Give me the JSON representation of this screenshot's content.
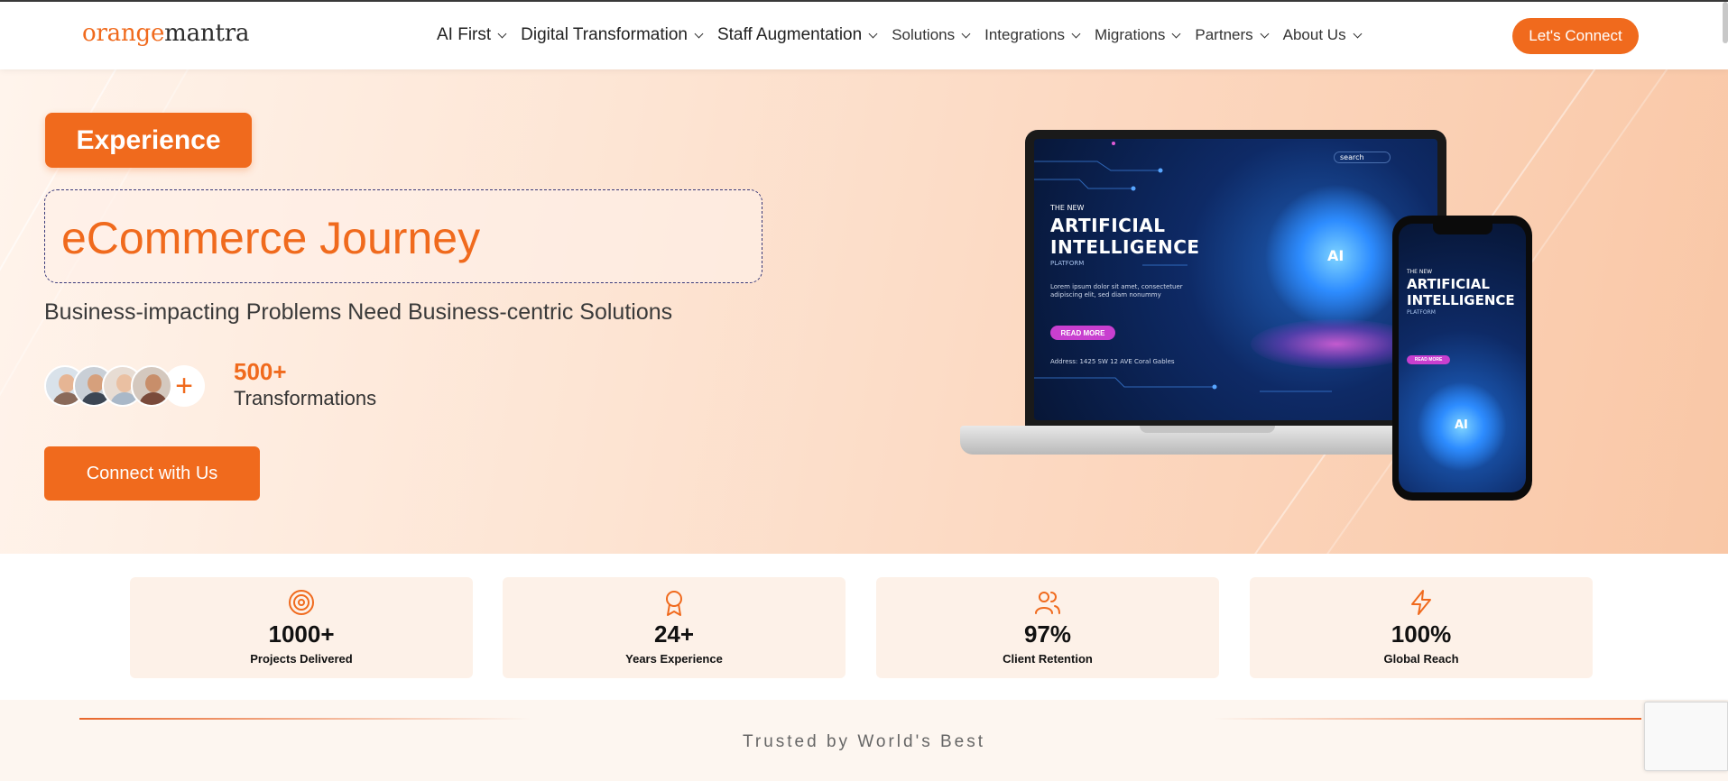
{
  "header": {
    "logo": {
      "part1": "orange",
      "part2": "mantra"
    },
    "nav": [
      {
        "label": "AI First",
        "size": "big"
      },
      {
        "label": "Digital Transformation",
        "size": "big"
      },
      {
        "label": "Staff Augmentation",
        "size": "big"
      },
      {
        "label": "Solutions",
        "size": "small"
      },
      {
        "label": "Integrations",
        "size": "small"
      },
      {
        "label": "Migrations",
        "size": "small"
      },
      {
        "label": "Partners",
        "size": "small"
      },
      {
        "label": "About Us",
        "size": "small"
      }
    ],
    "cta_label": "Let's Connect"
  },
  "hero": {
    "badge": "Experience",
    "headline": "eCommerce Journey",
    "subline": "Business-impacting Problems Need Business-centric Solutions",
    "avatar_plus": "+",
    "stat_value": "500+",
    "stat_label": "Transformations",
    "cta_label": "Connect with Us",
    "laptop_screen": {
      "search": "search",
      "eyebrow": "THE NEW",
      "title_line1": "ARTIFICIAL",
      "title_line2": "INTELLIGENCE",
      "platform": "PLATFORM",
      "body": "Lorem ipsum dolor sit amet, consectetuer adipiscing elit, sed diam nonummy",
      "button": "READ MORE",
      "address": "Address: 1425 SW 12 AVE Coral Gables",
      "ai_badge": "AI"
    },
    "phone_screen": {
      "eyebrow": "THE NEW",
      "title_line1": "ARTIFICIAL",
      "title_line2": "INTELLIGENCE",
      "platform": "PLATFORM",
      "button": "READ MORE",
      "ai_badge": "AI"
    }
  },
  "stats": [
    {
      "icon": "target-icon",
      "value": "1000+",
      "label": "Projects Delivered"
    },
    {
      "icon": "award-icon",
      "value": "24+",
      "label": "Years Experience"
    },
    {
      "icon": "users-icon",
      "value": "97%",
      "label": "Client Retention"
    },
    {
      "icon": "lightning-icon",
      "value": "100%",
      "label": "Global Reach"
    }
  ],
  "trusted": {
    "label": "Trusted by World's Best"
  },
  "colors": {
    "accent": "#f06a1d",
    "hero_bg": "#fde5d4",
    "card_bg": "#fdf1e8"
  }
}
